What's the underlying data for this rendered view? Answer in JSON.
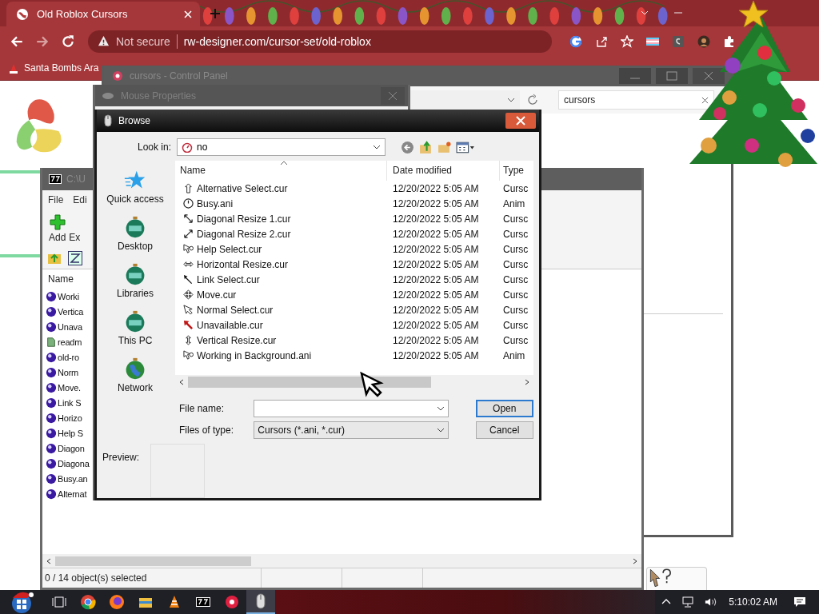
{
  "browser": {
    "tab": {
      "title": "Old Roblox Cursors"
    },
    "security": "Not secure",
    "url": "rw-designer.com/cursor-set/old-roblox",
    "bookmarks": [
      "Santa Bombs Ara"
    ]
  },
  "control_panel": {
    "title": "cursors - Control Panel",
    "search": "cursors"
  },
  "mouse_properties": {
    "title": "Mouse Properties"
  },
  "archiver": {
    "title": "C:\\U",
    "menu": [
      "File",
      "Edi"
    ],
    "toolbar": [
      "Add",
      "Ex"
    ],
    "column": "Name",
    "items": [
      {
        "name": "Worki",
        "kind": "cursor"
      },
      {
        "name": "Vertica",
        "kind": "cursor"
      },
      {
        "name": "Unava",
        "kind": "cursor"
      },
      {
        "name": "readm",
        "kind": "text"
      },
      {
        "name": "old-ro",
        "kind": "cursor"
      },
      {
        "name": "Norm",
        "kind": "cursor"
      },
      {
        "name": "Move.",
        "kind": "cursor"
      },
      {
        "name": "Link S",
        "kind": "cursor"
      },
      {
        "name": "Horizo",
        "kind": "cursor"
      },
      {
        "name": "Help S",
        "kind": "cursor"
      },
      {
        "name": "Diagon",
        "kind": "cursor"
      },
      {
        "name": "Diagona",
        "kind": "cursor"
      },
      {
        "name": "Busy.an",
        "kind": "cursor"
      },
      {
        "name": "Alternat",
        "kind": "cursor"
      }
    ],
    "status": "0 / 14 object(s) selected"
  },
  "browse": {
    "title": "Browse",
    "look_in_label": "Look in:",
    "look_in": "no",
    "places": [
      {
        "label": "Quick access",
        "kind": "star"
      },
      {
        "label": "Desktop",
        "kind": "ornament"
      },
      {
        "label": "Libraries",
        "kind": "ornament"
      },
      {
        "label": "This PC",
        "kind": "ornament"
      },
      {
        "label": "Network",
        "kind": "globe"
      }
    ],
    "columns": [
      "Name",
      "Date modified",
      "Type"
    ],
    "files": [
      {
        "name": "Alternative Select.cur",
        "date": "12/20/2022 5:05 AM",
        "type": "Cursc",
        "kind": "up"
      },
      {
        "name": "Busy.ani",
        "date": "12/20/2022 5:05 AM",
        "type": "Anim",
        "kind": "busy"
      },
      {
        "name": "Diagonal Resize 1.cur",
        "date": "12/20/2022 5:05 AM",
        "type": "Cursc",
        "kind": "diag1"
      },
      {
        "name": "Diagonal Resize 2.cur",
        "date": "12/20/2022 5:05 AM",
        "type": "Cursc",
        "kind": "diag2"
      },
      {
        "name": "Help Select.cur",
        "date": "12/20/2022 5:05 AM",
        "type": "Cursc",
        "kind": "help"
      },
      {
        "name": "Horizontal Resize.cur",
        "date": "12/20/2022 5:05 AM",
        "type": "Cursc",
        "kind": "horiz"
      },
      {
        "name": "Link Select.cur",
        "date": "12/20/2022 5:05 AM",
        "type": "Cursc",
        "kind": "link"
      },
      {
        "name": "Move.cur",
        "date": "12/20/2022 5:05 AM",
        "type": "Cursc",
        "kind": "move"
      },
      {
        "name": "Normal Select.cur",
        "date": "12/20/2022 5:05 AM",
        "type": "Cursc",
        "kind": "arrow"
      },
      {
        "name": "Unavailable.cur",
        "date": "12/20/2022 5:05 AM",
        "type": "Cursc",
        "kind": "unavailable"
      },
      {
        "name": "Vertical Resize.cur",
        "date": "12/20/2022 5:05 AM",
        "type": "Cursc",
        "kind": "vert"
      },
      {
        "name": "Working in Background.ani",
        "date": "12/20/2022 5:05 AM",
        "type": "Anim",
        "kind": "help"
      }
    ],
    "file_name_label": "File name:",
    "files_of_type_label": "Files of type:",
    "files_of_type": "Cursors (*.ani, *.cur)",
    "buttons": [
      {
        "label": "Open",
        "default": true
      },
      {
        "label": "Cancel",
        "default": false
      }
    ],
    "preview_label": "Preview:"
  },
  "taskbar": {
    "time": "5:10:02 AM"
  }
}
